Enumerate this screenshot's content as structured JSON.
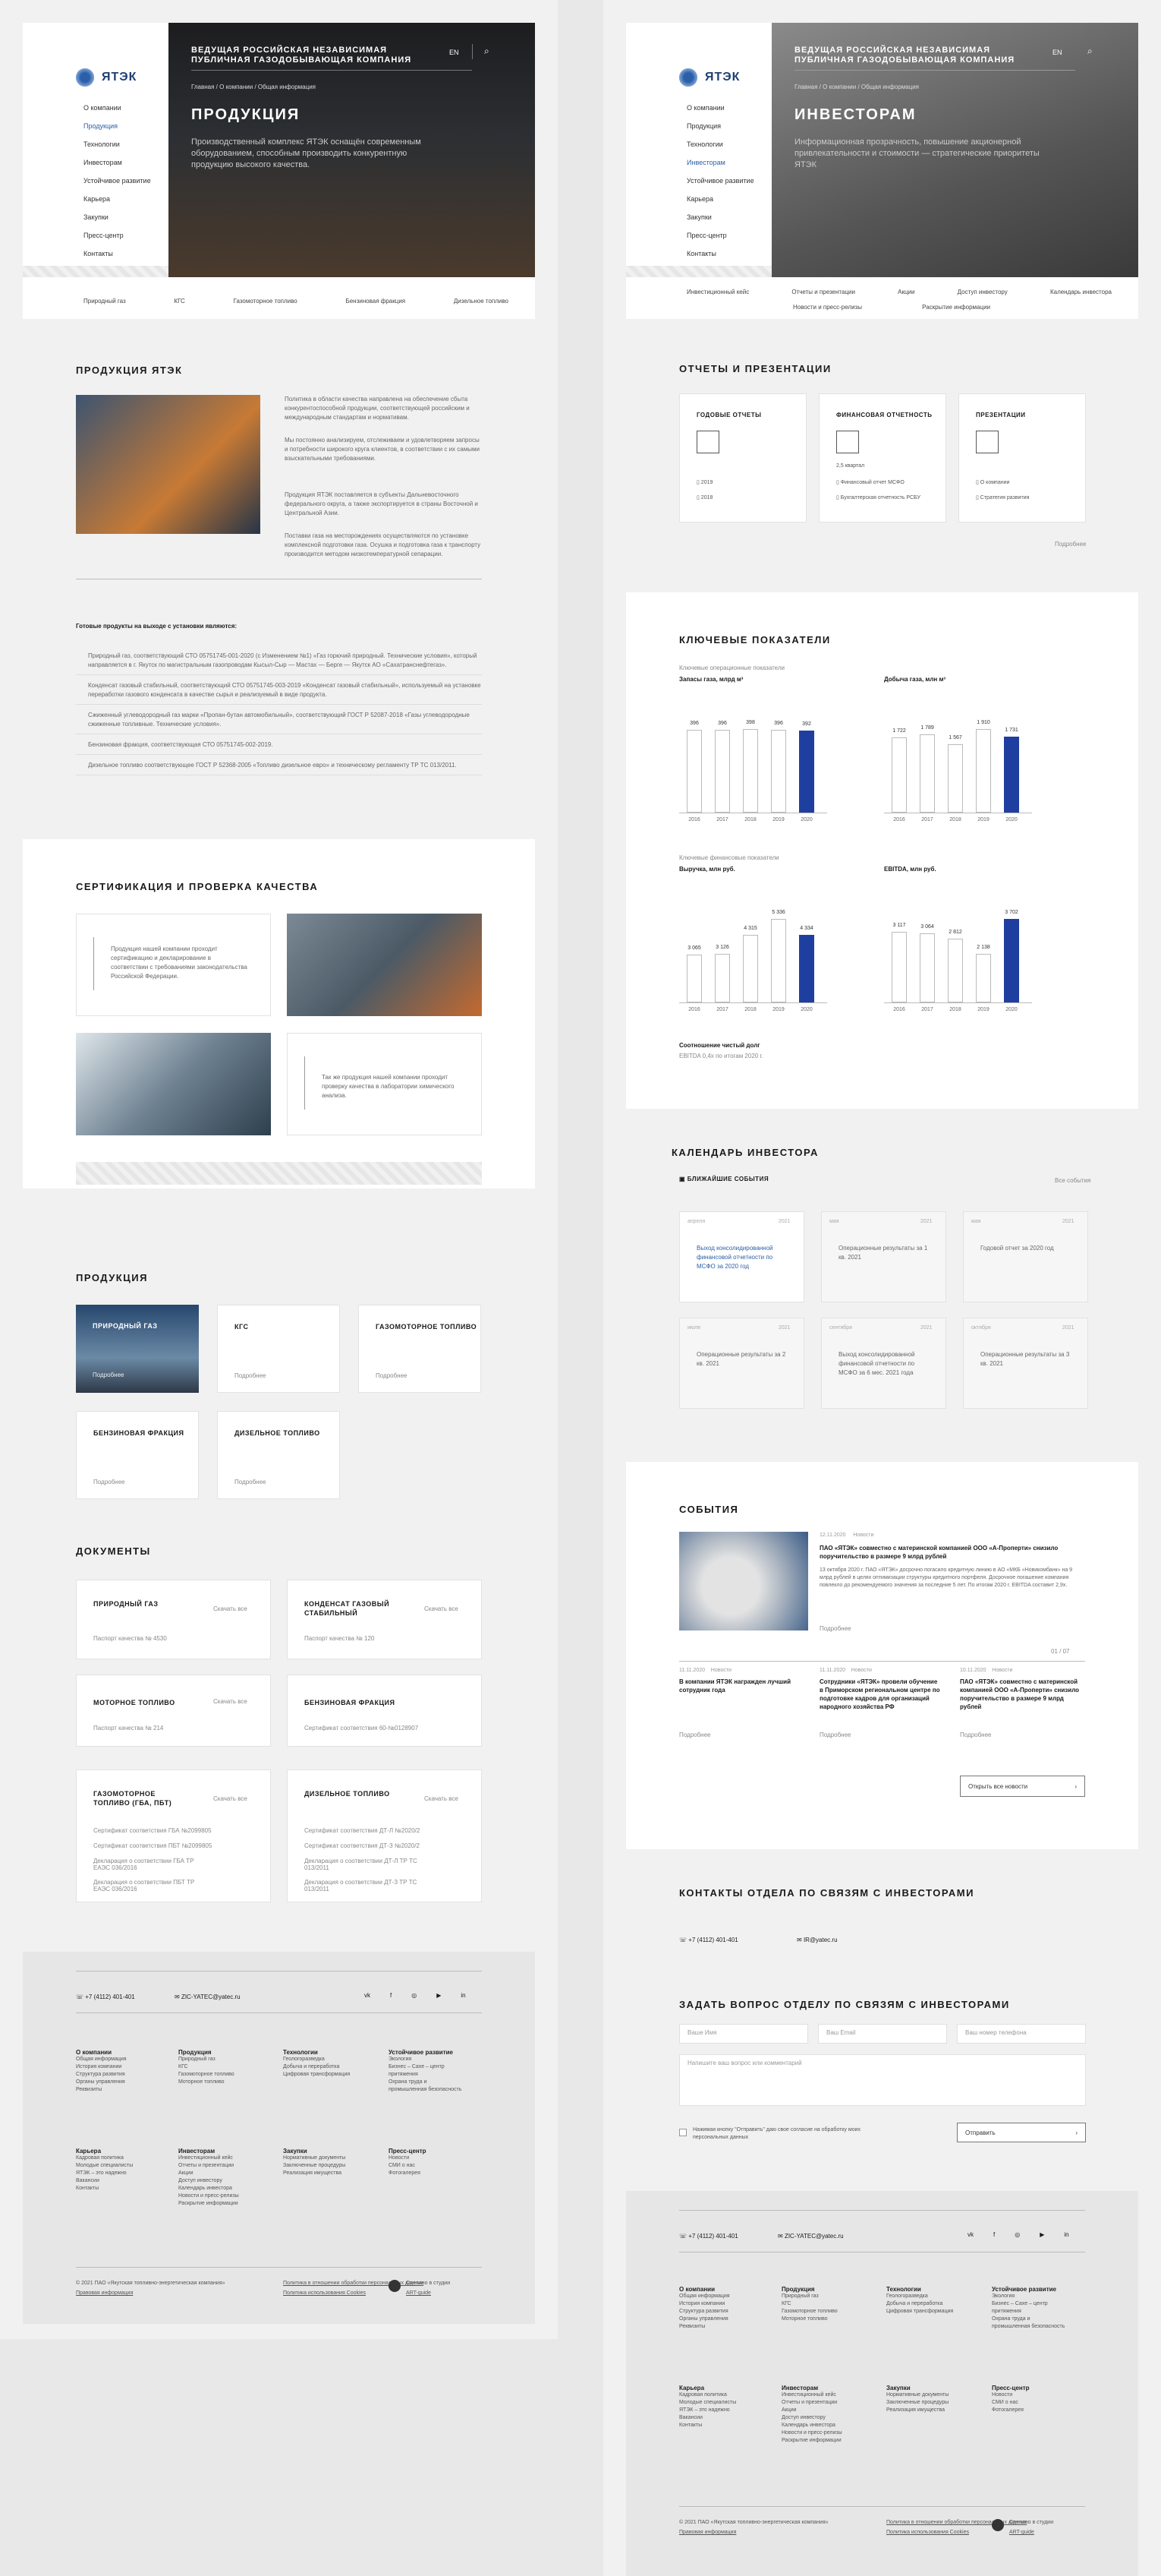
{
  "left": {
    "logo": "ЯТЭК",
    "nav": [
      "О компании",
      "Продукция",
      "Технологии",
      "Инвесторам",
      "Устойчивое развитие",
      "Карьера",
      "Закупки",
      "Пресс-центр",
      "Контакты"
    ],
    "header_tagline": "Ведущая российская независимая публичная газодобывающая компания",
    "lang": "EN",
    "breadcrumb": "Главная  /  О компании  /  Общая информация",
    "hero_title": "Продукция",
    "hero_desc": "Производственный комплекс ЯТЭК оснащён современным оборудованием, способным производить конкурентную продукцию высокого качества.",
    "tabs": [
      "Природный газ",
      "КГС",
      "Газомоторное топливо",
      "Бензиновая фракция",
      "Дизельное топливо"
    ],
    "about_title": "Продукция ЯТЭК",
    "about_p1": "Политика в области качества направлена на обеспечение сбыта конкурентоспособной продукции, соответствующей российским и международным стандартам и нормативам.",
    "about_p2": "Мы постоянно анализируем, отслеживаем и удовлетворяем запросы и потребности широкого круга клиентов, в соответствии с их самыми взыскательными требованиями.",
    "about_p3": "Продукция ЯТЭК поставляется в субъекты Дальневосточного федерального округа, а также экспортируется в страны Восточной и Центральной Азии.",
    "about_p4": "Поставки газа на месторождениях осуществляются по установке комплексной подготовки газа. Осушка и подготовка газа к транспорту производится методом низкотемпературной сепарации.",
    "ready_title": "Готовые продукты на выходе с установки являются:",
    "ready_items": [
      "Природный газ, соответствующий СТО 05751745-001-2020 (с Изменением №1) «Газ горючий природный. Технические условия», который направляется в г. Якутск по магистральным газопроводам Кысыл-Сыр — Мастах — Берге — Якутск АО «Сахатранснефтегаз».",
      "Конденсат газовый стабильный, соответствующий СТО 05751745-003-2019 «Конденсат газовый стабильный», используемый на установке переработки газового конденсата в качестве сырья и реализуемый в виде продукта.",
      "Сжиженный углеводородный газ марки «Пропан-бутан автомобильный», соответствующий ГОСТ Р 52087-2018 «Газы углеводородные сжиженные топливные. Технические условия».",
      "Бензиновая фракция, соответствующая СТО 05751745-002-2019.",
      "Дизельное топливо соответствующее ГОСТ Р 52368-2005 «Топливо дизельное евро» и техническому регламенту ТР ТС 013/2011."
    ],
    "cert_title": "Сертификация и проверка качества",
    "cert_text1": "Продукция нашей компании проходит сертификацию и декларирование в соответствии с требованиями законодательства Российской Федерации.",
    "cert_text2": "Так же продукция нашей компании проходит проверку качества в лаборатории химического анализа.",
    "products_title": "Продукция",
    "products": [
      "Природный газ",
      "КГС",
      "Газомоторное топливо",
      "Бензиновая фракция",
      "Дизельное топливо"
    ],
    "more": "Подробнее",
    "docs_title": "Документы",
    "docs": [
      {
        "title": "Природный газ",
        "lines": [
          "Паспорт качества № 4530"
        ]
      },
      {
        "title": "Конденсат газовый стабильный",
        "lines": [
          "Паспорт качества № 120"
        ]
      },
      {
        "title": "Моторное топливо",
        "lines": [
          "Паспорт качества № 214"
        ]
      },
      {
        "title": "Бензиновая фракция",
        "lines": [
          "Сертификат соответствия 60-№0128907"
        ]
      },
      {
        "title": "Газомоторное топливо (ГБА, ПБТ)",
        "lines": [
          "Сертификат соответствия ГБА №2099805",
          "Сертификат соответствия ПБТ №2099805",
          "Декларация о соответствии ГБА ТР ЕАЭС 036/2016",
          "Декларация о соответствии ПБТ ТР ЕАЭС 036/2016"
        ]
      },
      {
        "title": "Дизельное топливо",
        "lines": [
          "Сертификат соответствия ДТ-Л №2020/2",
          "Сертификат соответствия ДТ-З №2020/2",
          "Декларация о соответствии ДТ-Л ТР ТС 013/2011",
          "Декларация о соответствии ДТ-З ТР ТС 013/2011"
        ]
      }
    ],
    "docs_link": "Скачать все"
  },
  "right": {
    "hero_title": "Инвесторам",
    "breadcrumb": "Главная  /  О компании  /  Общая информация",
    "hero_desc": "Информационная прозрачность, повышение акционерной привлекательности и стоимости — стратегические приоритеты ЯТЭК",
    "tabs_row1": [
      "Инвестиционный кейс",
      "Отчеты и презентации",
      "Акции",
      "Доступ инвестору",
      "Календарь инвестора"
    ],
    "tabs_row2": [
      "Новости и пресс-релизы",
      "Раскрытие информации"
    ],
    "reports_title": "Отчеты и презентации",
    "reports": [
      {
        "title": "Годовые отчеты",
        "items": [
          "2019",
          "2018"
        ],
        "note": ""
      },
      {
        "title": "Финансовая отчетность",
        "items": [
          "Финансовый отчет МСФО",
          "Бухгалтерская отчетность РСБУ"
        ],
        "note": "2,5 квартал"
      },
      {
        "title": "Презентации",
        "items": [
          "О компании",
          "Стратегия развития"
        ],
        "note": ""
      }
    ],
    "reports_more": "Подробнее",
    "kpi_title": "Ключевые показатели",
    "kpi_op": "Ключевые операционные показатели",
    "kpi_fin": "Ключевые финансовые показатели",
    "debt_label": "Соотношение чистый долг",
    "debt_value": "EBITDA 0,4х по итогам 2020 г."
  },
  "chart_data": [
    {
      "type": "bar",
      "title": "Запасы газа, млрд м³",
      "categories": [
        "2016",
        "2017",
        "2018",
        "2019",
        "2020"
      ],
      "values": [
        396,
        396,
        398,
        396,
        392
      ]
    },
    {
      "type": "bar",
      "title": "Добыча газа, млн м³",
      "categories": [
        "2016",
        "2017",
        "2018",
        "2019",
        "2020"
      ],
      "values": [
        1722,
        1789,
        1567,
        1910,
        1731
      ]
    },
    {
      "type": "bar",
      "title": "Выручка, млн руб.",
      "categories": [
        "2016",
        "2017",
        "2018",
        "2019",
        "2020"
      ],
      "values": [
        3065,
        3126,
        4315,
        5336,
        4334
      ]
    },
    {
      "type": "bar",
      "title": "EBITDA, млн руб.",
      "categories": [
        "2016",
        "2017",
        "2018",
        "2019",
        "2020"
      ],
      "values": [
        3117,
        3064,
        2812,
        2138,
        3702
      ]
    }
  ],
  "calendar": {
    "title": "Календарь инвестора",
    "sub": "Ближайшие события",
    "all": "Все события",
    "events": [
      {
        "when": "апреля",
        "year": "2021",
        "text": "Выход консолидированной финансовой отчетности по МСФО за 2020 год"
      },
      {
        "when": "мая",
        "year": "2021",
        "text": "Операционные результаты за 1 кв. 2021"
      },
      {
        "when": "мая",
        "year": "2021",
        "text": "Годовой отчет за 2020 год"
      },
      {
        "when": "июля",
        "year": "2021",
        "text": "Операционные результаты за 2 кв. 2021"
      },
      {
        "when": "сентября",
        "year": "2021",
        "text": "Выход консолидированной финансовой отчетности по МСФО за 6 мес. 2021 года"
      },
      {
        "when": "октября",
        "year": "2021",
        "text": "Операционные результаты за 3 кв. 2021"
      }
    ]
  },
  "news": {
    "title": "События",
    "main_date": "12.11.2020",
    "main_tag": "Новости",
    "main_title": "ПАО «ЯТЭК» совместно с материнской компанией ООО «А-Проперти» снизило поручительство в размере 9 млрд рублей",
    "main_text": "13 октября 2020 г. ПАО «ЯТЭК» досрочно погасило кредитную линию в АО «МКБ «Новикомбанк» на 9 млрд рублей в целях оптимизации структуры кредитного портфеля. Досрочное погашение компания повлекло до рекомендуемого значения за последние 5 лет. По итогам 2020 г. EBITDA составит 2,9х.",
    "pager": "01 / 07",
    "items": [
      {
        "date": "11.11.2020",
        "tag": "Новости",
        "title": "В компании ЯТЭК награжден лучший сотрудник года"
      },
      {
        "date": "11.11.2020",
        "tag": "Новости",
        "title": "Сотрудники «ЯТЭК» провели обучение в Приморском региональном центре по подготовке кадров для организаций народного хозяйства РФ"
      },
      {
        "date": "10.11.2020",
        "tag": "Новости",
        "title": "ПАО «ЯТЭК» совместно с материнской компанией ООО «А-Проперти» снизило поручительство в размере 9 млрд рублей"
      }
    ],
    "open_all": "Открыть все новости"
  },
  "contacts": {
    "title": "Контакты отдела по связям с инвесторами",
    "phone": "+7 (4112) 401-401",
    "email": "IR@yatec.ru"
  },
  "form": {
    "title": "Задать вопрос отделу по связям с инвесторами",
    "name_ph": "Ваше Имя",
    "email_ph": "Ваш Email",
    "phone_ph": "Ваш номер телефона",
    "msg_ph": "Напишите ваш вопрос или комментарий",
    "consent": "Нажимая кнопку \"Отправить\" даю свое согласие на обработку моих персональных данных",
    "send": "Отправить"
  },
  "footer": {
    "phone": "+7 (4112) 401-401",
    "email": "ZIC-YATEC@yatec.ru",
    "socials": [
      "vk",
      "fb",
      "ig",
      "yt",
      "in"
    ],
    "cols": [
      {
        "title": "О компании",
        "items": [
          "Общая информация",
          "История компании",
          "Структура развития",
          "Органы управления",
          "Реквизиты"
        ]
      },
      {
        "title": "Продукция",
        "items": [
          "Природный газ",
          "КГС",
          "Газомоторное топливо",
          "Моторное топливо"
        ]
      },
      {
        "title": "Технологии",
        "items": [
          "Геологоразведка",
          "Добыча и переработка",
          "Цифровая трансформация"
        ]
      },
      {
        "title": "Устойчивое развитие",
        "items": [
          "Экология",
          "Бизнес – Сахе – центр притяжения",
          "Охрана труда и промышленная безопасность"
        ]
      },
      {
        "title": "Карьера",
        "items": [
          "Кадровая политика",
          "Молодые специалисты",
          "ЯТЭК – это надежно",
          "Вакансии",
          "Контакты"
        ]
      },
      {
        "title": "Инвесторам",
        "items": [
          "Инвестиционный кейс",
          "Отчеты и презентации",
          "Акции",
          "Доступ инвестору",
          "Календарь инвестора",
          "Новости и пресс-релизы",
          "Раскрытие информации"
        ]
      },
      {
        "title": "Закупки",
        "items": [
          "Нормативные документы",
          "Заключенные процедуры",
          "Реализация имущества"
        ]
      },
      {
        "title": "Пресс-центр",
        "items": [
          "Новости",
          "СМИ о нас",
          "Фотогалерея"
        ]
      }
    ],
    "copy": "© 2021 ПАО «Якутская топливно-энергетическая компания»",
    "legal": "Правовая информация",
    "privacy": "Политика в отношении обработки персональных данных",
    "cookies": "Политика использования Cookies",
    "made": "Сделано в студии",
    "studio": "ART-guide"
  }
}
